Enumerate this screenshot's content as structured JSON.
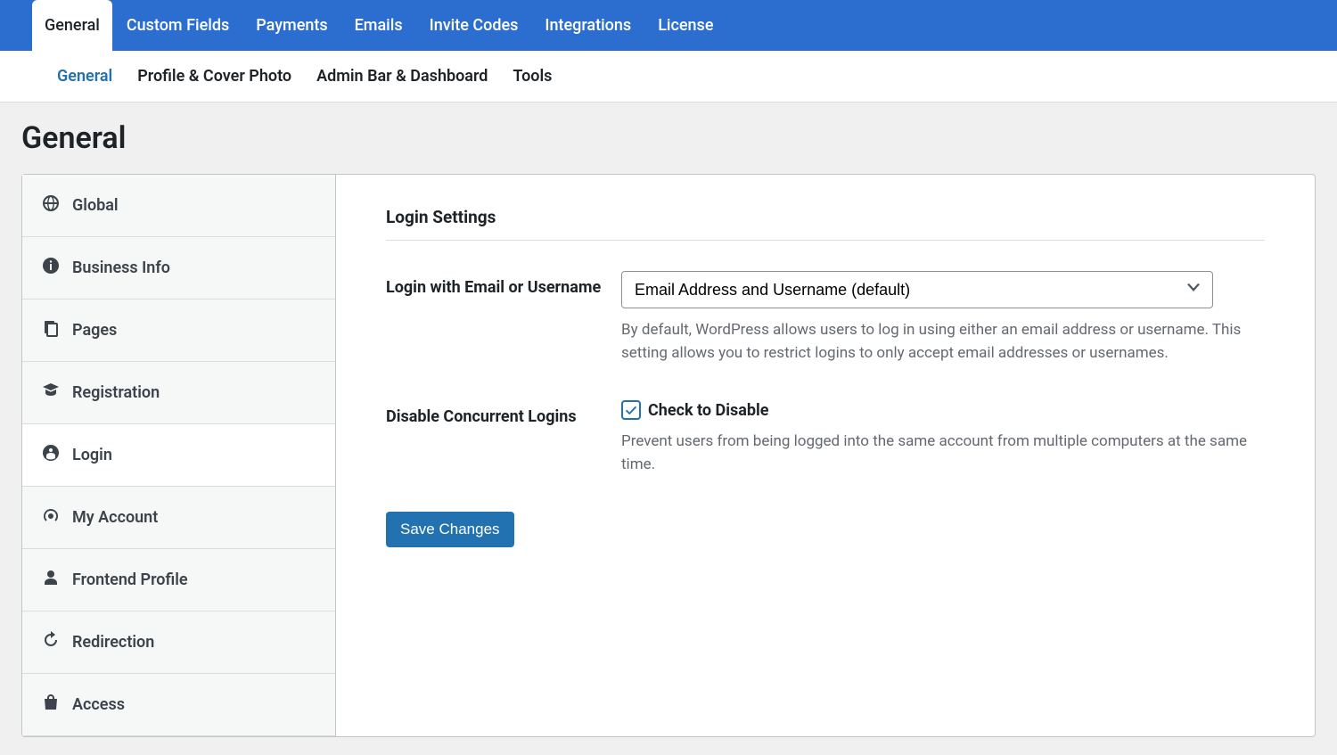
{
  "top_tabs": {
    "items": [
      "General",
      "Custom Fields",
      "Payments",
      "Emails",
      "Invite Codes",
      "Integrations",
      "License"
    ],
    "active_index": 0
  },
  "sub_tabs": {
    "items": [
      "General",
      "Profile & Cover Photo",
      "Admin Bar & Dashboard",
      "Tools"
    ],
    "active_index": 0
  },
  "page_title": "General",
  "sidebar": {
    "items": [
      {
        "icon": "globe",
        "label": "Global"
      },
      {
        "icon": "info",
        "label": "Business Info"
      },
      {
        "icon": "pages",
        "label": "Pages"
      },
      {
        "icon": "grad",
        "label": "Registration"
      },
      {
        "icon": "access",
        "label": "Login"
      },
      {
        "icon": "gauge",
        "label": "My Account"
      },
      {
        "icon": "user",
        "label": "Frontend Profile"
      },
      {
        "icon": "redirect",
        "label": "Redirection"
      },
      {
        "icon": "bag",
        "label": "Access"
      }
    ],
    "active_index": 4
  },
  "section_title": "Login Settings",
  "fields": {
    "login_method": {
      "label": "Login with Email or Username",
      "selected": "Email Address and Username (default)",
      "help": "By default, WordPress allows users to log in using either an email address or username. This setting allows you to restrict logins to only accept email addresses or usernames."
    },
    "disable_concurrent": {
      "label": "Disable Concurrent Logins",
      "checkbox_label": "Check to Disable",
      "checked": true,
      "help": "Prevent users from being logged into the same account from multiple computers at the same time."
    }
  },
  "save_button": "Save Changes"
}
